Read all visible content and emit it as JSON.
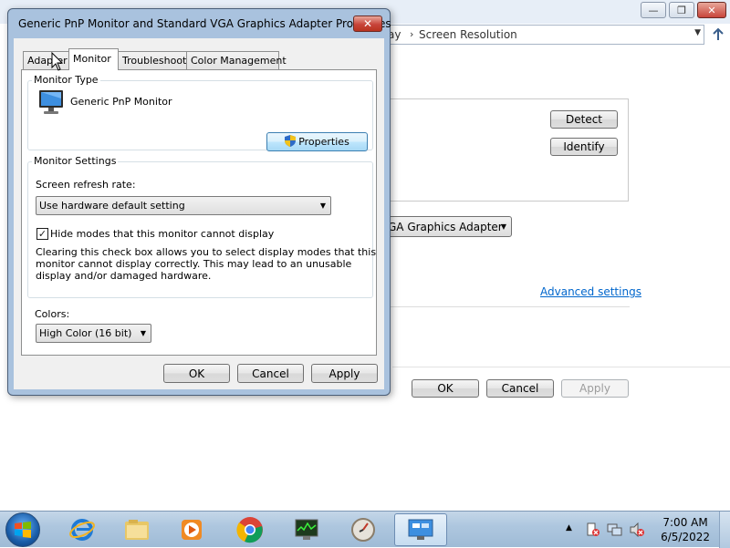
{
  "background_window": {
    "breadcrumb_prev": "ay",
    "breadcrumb_sep": "›",
    "breadcrumb_current": "Screen Resolution",
    "minimize_glyph": "—",
    "maximize_glyph": "❐",
    "close_glyph": "✕",
    "detect_label": "Detect",
    "identify_label": "Identify",
    "display_dropdown_value": "GA Graphics Adapter",
    "advanced_settings_link": "Advanced settings",
    "ok_label": "OK",
    "cancel_label": "Cancel",
    "apply_label": "Apply"
  },
  "dialog": {
    "title": "Generic PnP Monitor and Standard VGA Graphics Adapter Properties",
    "close_glyph": "✕",
    "tabs": [
      {
        "label": "Adapter"
      },
      {
        "label": "Monitor"
      },
      {
        "label": "Troubleshoot"
      },
      {
        "label": "Color Management"
      }
    ],
    "active_tab": "Monitor",
    "monitor_type": {
      "group_label": "Monitor Type",
      "monitor_name": "Generic PnP Monitor",
      "properties_button": "Properties"
    },
    "monitor_settings": {
      "group_label": "Monitor Settings",
      "refresh_label": "Screen refresh rate:",
      "refresh_value": "Use hardware default setting",
      "hide_modes_checked": true,
      "hide_modes_label": "Hide modes that this monitor cannot display",
      "warning_lines": [
        "Clearing this check box allows you to select display modes that this",
        "monitor cannot display correctly. This may lead to an unusable",
        "display and/or damaged hardware."
      ]
    },
    "colors": {
      "label": "Colors:",
      "value": "High Color (16 bit)"
    },
    "buttons": {
      "ok": "OK",
      "cancel": "Cancel",
      "apply": "Apply"
    }
  },
  "taskbar": {
    "pinned": [
      "ie-icon",
      "explorer-icon",
      "media-player-icon",
      "chrome-icon",
      "task-manager-icon",
      "clock-gadget-icon",
      "display-settings-icon"
    ],
    "active_item": "display-settings-icon",
    "tray_arrow": "▲",
    "time": "7:00 AM",
    "date": "6/5/2022"
  }
}
